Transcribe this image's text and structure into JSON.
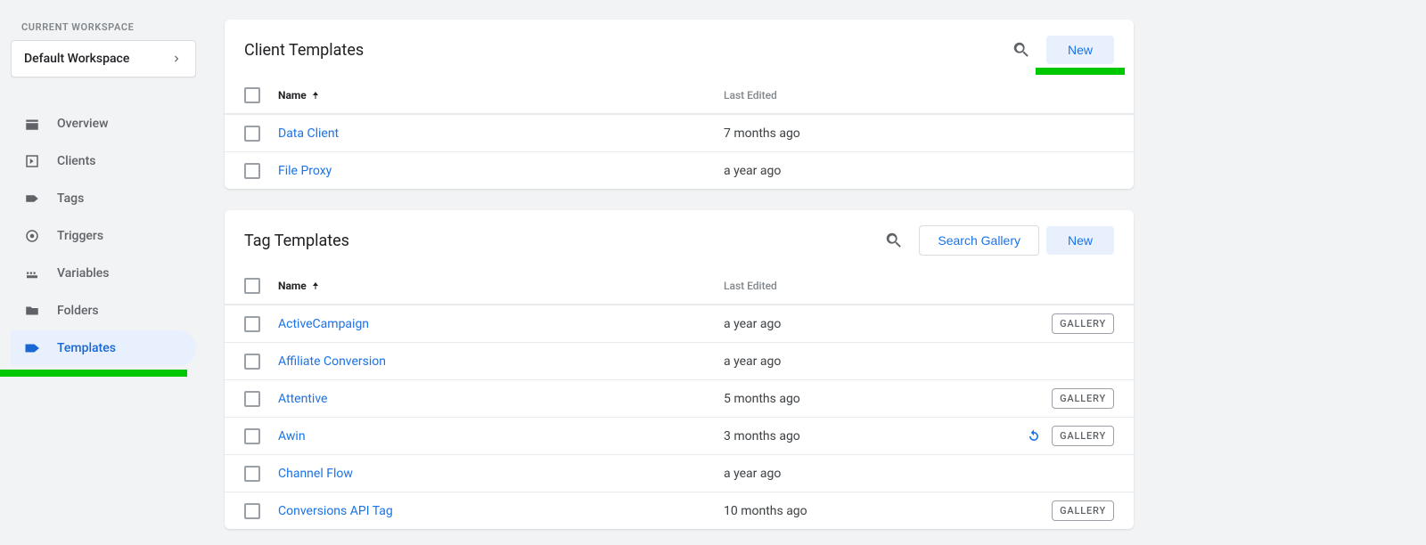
{
  "sidebar": {
    "workspace_label": "CURRENT WORKSPACE",
    "workspace_name": "Default Workspace",
    "items": [
      {
        "label": "Overview"
      },
      {
        "label": "Clients"
      },
      {
        "label": "Tags"
      },
      {
        "label": "Triggers"
      },
      {
        "label": "Variables"
      },
      {
        "label": "Folders"
      },
      {
        "label": "Templates"
      }
    ]
  },
  "client_panel": {
    "title": "Client Templates",
    "new_label": "New",
    "col_name": "Name",
    "col_edited": "Last Edited",
    "rows": [
      {
        "name": "Data Client",
        "edited": "7 months ago"
      },
      {
        "name": "File Proxy",
        "edited": "a year ago"
      }
    ]
  },
  "tag_panel": {
    "title": "Tag Templates",
    "search_gallery": "Search Gallery",
    "new_label": "New",
    "col_name": "Name",
    "col_edited": "Last Edited",
    "gallery_badge": "GALLERY",
    "rows": [
      {
        "name": "ActiveCampaign",
        "edited": "a year ago",
        "gallery": true,
        "refresh": false
      },
      {
        "name": "Affiliate Conversion",
        "edited": "a year ago",
        "gallery": false,
        "refresh": false
      },
      {
        "name": "Attentive",
        "edited": "5 months ago",
        "gallery": true,
        "refresh": false
      },
      {
        "name": "Awin",
        "edited": "3 months ago",
        "gallery": true,
        "refresh": true
      },
      {
        "name": "Channel Flow",
        "edited": "a year ago",
        "gallery": false,
        "refresh": false
      },
      {
        "name": "Conversions API Tag",
        "edited": "10 months ago",
        "gallery": true,
        "refresh": false
      }
    ]
  }
}
